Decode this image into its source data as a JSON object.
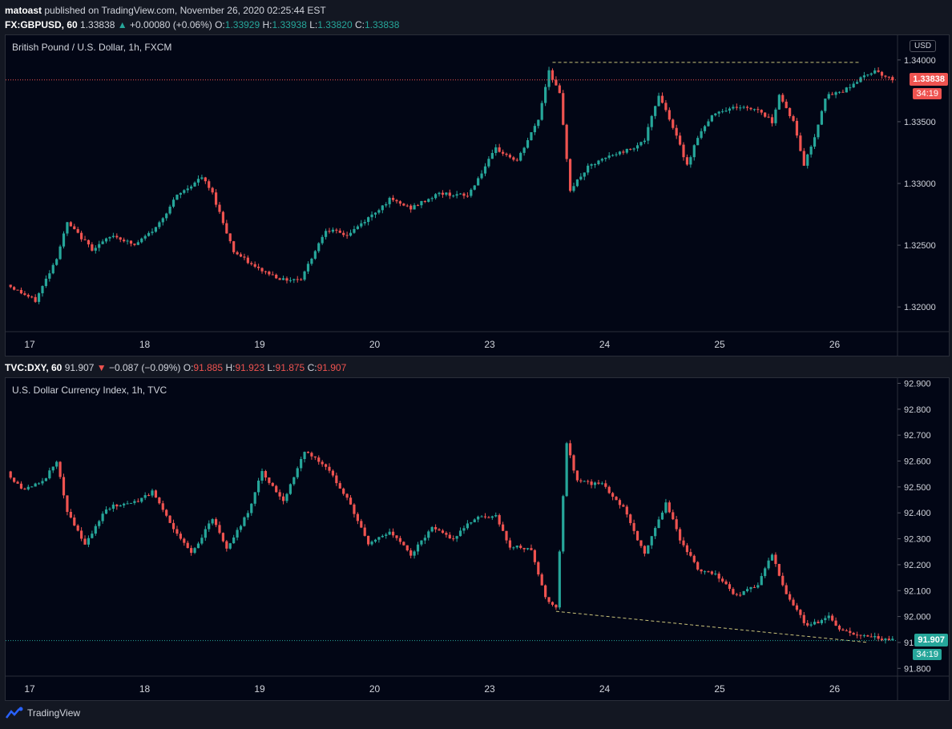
{
  "header": {
    "author": "matoast",
    "published_text": "published on TradingView.com, November 26, 2020 02:25:44 EST"
  },
  "top_info": {
    "symbol": "FX:GBPUSD, 60",
    "last": "1.33838",
    "arrow": "▲",
    "change": "+0.00080 (+0.06%)",
    "o_label": "O:",
    "o": "1.33929",
    "h_label": "H:",
    "h": "1.33938",
    "l_label": "L:",
    "l": "1.33820",
    "c_label": "C:",
    "c": "1.33838"
  },
  "bottom_info": {
    "symbol": "TVC:DXY, 60",
    "last": "91.907",
    "arrow": "▼",
    "change": "−0.087 (−0.09%)",
    "o_label": "O:",
    "o": "91.885",
    "h_label": "H:",
    "h": "91.923",
    "l_label": "L:",
    "l": "91.875",
    "c_label": "C:",
    "c": "91.907"
  },
  "footer": {
    "brand": "TradingView"
  },
  "colors": {
    "up": "#26a69a",
    "down": "#ef5350",
    "background": "#020615",
    "grid": "#131722"
  },
  "chart_data": [
    {
      "type": "candlestick",
      "title": "British Pound / U.S. Dollar, 1h, FXCM",
      "currency": "USD",
      "last_price": "1.33838",
      "countdown": "34:19",
      "x_tick_labels": [
        "17",
        "18",
        "19",
        "20",
        "23",
        "24",
        "25",
        "26"
      ],
      "y_ticks": [
        1.32,
        1.325,
        1.33,
        1.335,
        1.34
      ],
      "y_tick_labels": [
        "1.32000",
        "1.32500",
        "1.33000",
        "1.33500",
        "1.34000"
      ],
      "ylim": [
        1.318,
        1.342
      ],
      "anchors": [
        {
          "t": 0,
          "v": 1.3218
        },
        {
          "t": 8,
          "v": 1.3205
        },
        {
          "t": 14,
          "v": 1.324
        },
        {
          "t": 17,
          "v": 1.3268
        },
        {
          "t": 24,
          "v": 1.3247
        },
        {
          "t": 30,
          "v": 1.3258
        },
        {
          "t": 36,
          "v": 1.325
        },
        {
          "t": 42,
          "v": 1.3264
        },
        {
          "t": 48,
          "v": 1.329
        },
        {
          "t": 55,
          "v": 1.3305
        },
        {
          "t": 58,
          "v": 1.3292
        },
        {
          "t": 64,
          "v": 1.3245
        },
        {
          "t": 70,
          "v": 1.3232
        },
        {
          "t": 78,
          "v": 1.3222
        },
        {
          "t": 83,
          "v": 1.3223
        },
        {
          "t": 90,
          "v": 1.3263
        },
        {
          "t": 96,
          "v": 1.3258
        },
        {
          "t": 102,
          "v": 1.3272
        },
        {
          "t": 108,
          "v": 1.3287
        },
        {
          "t": 114,
          "v": 1.328
        },
        {
          "t": 122,
          "v": 1.3292
        },
        {
          "t": 130,
          "v": 1.329
        },
        {
          "t": 138,
          "v": 1.3328
        },
        {
          "t": 144,
          "v": 1.3318
        },
        {
          "t": 150,
          "v": 1.3352
        },
        {
          "t": 153,
          "v": 1.3392
        },
        {
          "t": 156,
          "v": 1.3372
        },
        {
          "t": 159,
          "v": 1.3295
        },
        {
          "t": 164,
          "v": 1.3313
        },
        {
          "t": 170,
          "v": 1.3322
        },
        {
          "t": 176,
          "v": 1.3328
        },
        {
          "t": 180,
          "v": 1.3335
        },
        {
          "t": 184,
          "v": 1.3372
        },
        {
          "t": 187,
          "v": 1.3353
        },
        {
          "t": 192,
          "v": 1.3315
        },
        {
          "t": 195,
          "v": 1.3338
        },
        {
          "t": 200,
          "v": 1.3358
        },
        {
          "t": 206,
          "v": 1.3362
        },
        {
          "t": 212,
          "v": 1.336
        },
        {
          "t": 216,
          "v": 1.335
        },
        {
          "t": 218,
          "v": 1.3372
        },
        {
          "t": 222,
          "v": 1.335
        },
        {
          "t": 225,
          "v": 1.3315
        },
        {
          "t": 228,
          "v": 1.3338
        },
        {
          "t": 231,
          "v": 1.337
        },
        {
          "t": 236,
          "v": 1.3375
        },
        {
          "t": 241,
          "v": 1.3385
        },
        {
          "t": 245,
          "v": 1.3392
        },
        {
          "t": 249,
          "v": 1.3385
        }
      ],
      "annotations": [
        {
          "type": "horizontal-dashed",
          "v": 1.3398,
          "t_from": 153,
          "t_to": 240
        }
      ]
    },
    {
      "type": "candlestick",
      "title": "U.S. Dollar Currency Index, 1h, TVC",
      "currency": "USD",
      "last_price": "91.907",
      "countdown": "34:19",
      "x_tick_labels": [
        "17",
        "18",
        "19",
        "20",
        "23",
        "24",
        "25",
        "26"
      ],
      "y_ticks": [
        91.8,
        91.9,
        92.0,
        92.1,
        92.2,
        92.3,
        92.4,
        92.5,
        92.6,
        92.7,
        92.8,
        92.9
      ],
      "y_tick_labels": [
        "91.800",
        "91.900",
        "92.000",
        "92.100",
        "92.200",
        "92.300",
        "92.400",
        "92.500",
        "92.600",
        "92.700",
        "92.800",
        "92.900"
      ],
      "ylim": [
        91.77,
        92.92
      ],
      "anchors": [
        {
          "t": 0,
          "v": 92.56
        },
        {
          "t": 4,
          "v": 92.49
        },
        {
          "t": 10,
          "v": 92.52
        },
        {
          "t": 14,
          "v": 92.6
        },
        {
          "t": 17,
          "v": 92.4
        },
        {
          "t": 22,
          "v": 92.28
        },
        {
          "t": 28,
          "v": 92.42
        },
        {
          "t": 36,
          "v": 92.44
        },
        {
          "t": 41,
          "v": 92.48
        },
        {
          "t": 46,
          "v": 92.36
        },
        {
          "t": 52,
          "v": 92.24
        },
        {
          "t": 58,
          "v": 92.38
        },
        {
          "t": 62,
          "v": 92.26
        },
        {
          "t": 68,
          "v": 92.4
        },
        {
          "t": 72,
          "v": 92.56
        },
        {
          "t": 78,
          "v": 92.44
        },
        {
          "t": 84,
          "v": 92.64
        },
        {
          "t": 90,
          "v": 92.58
        },
        {
          "t": 96,
          "v": 92.46
        },
        {
          "t": 102,
          "v": 92.28
        },
        {
          "t": 108,
          "v": 92.33
        },
        {
          "t": 114,
          "v": 92.24
        },
        {
          "t": 120,
          "v": 92.34
        },
        {
          "t": 126,
          "v": 92.3
        },
        {
          "t": 132,
          "v": 92.38
        },
        {
          "t": 138,
          "v": 92.39
        },
        {
          "t": 142,
          "v": 92.27
        },
        {
          "t": 148,
          "v": 92.26
        },
        {
          "t": 152,
          "v": 92.07
        },
        {
          "t": 155,
          "v": 92.04
        },
        {
          "t": 158,
          "v": 92.67
        },
        {
          "t": 161,
          "v": 92.52
        },
        {
          "t": 168,
          "v": 92.51
        },
        {
          "t": 174,
          "v": 92.42
        },
        {
          "t": 180,
          "v": 92.24
        },
        {
          "t": 186,
          "v": 92.44
        },
        {
          "t": 190,
          "v": 92.3
        },
        {
          "t": 195,
          "v": 92.18
        },
        {
          "t": 200,
          "v": 92.16
        },
        {
          "t": 206,
          "v": 92.08
        },
        {
          "t": 212,
          "v": 92.12
        },
        {
          "t": 216,
          "v": 92.24
        },
        {
          "t": 220,
          "v": 92.08
        },
        {
          "t": 226,
          "v": 91.96
        },
        {
          "t": 232,
          "v": 92.0
        },
        {
          "t": 236,
          "v": 91.94
        },
        {
          "t": 242,
          "v": 91.93
        },
        {
          "t": 249,
          "v": 91.91
        }
      ],
      "annotations": [
        {
          "type": "trendline-dashed",
          "t_from": 154,
          "v_from": 92.02,
          "t_to": 242,
          "v_to": 91.9
        }
      ]
    }
  ]
}
